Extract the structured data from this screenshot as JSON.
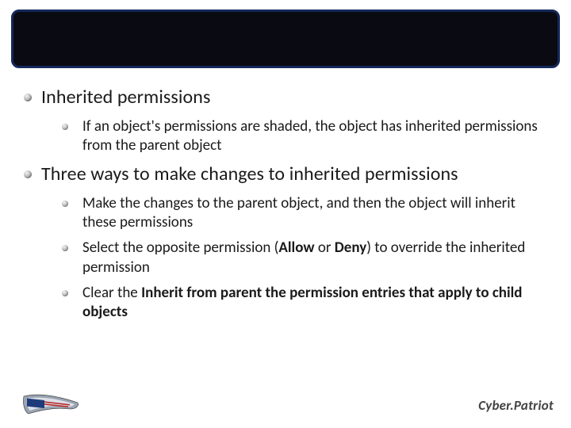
{
  "title": "",
  "content": {
    "items": [
      {
        "text": "Inherited permissions",
        "sub": [
          {
            "text": "If an object's permissions are shaded, the object has inherited permissions from the parent object"
          }
        ]
      },
      {
        "text": "Three ways to make changes to inherited permissions",
        "sub": [
          {
            "html": "Make the changes to the parent object, and then the object will inherit these permissions"
          },
          {
            "html": "Select the opposite permission (<b>Allow</b> or <b>Deny</b>) to override the inherited permission"
          },
          {
            "html": "Clear the <b>Inherit from parent the permission entries that apply to child objects</b>"
          }
        ]
      }
    ]
  },
  "footer": {
    "brand": "Cyber.Patriot",
    "logo_alt": "flag-ribbon-logo"
  }
}
